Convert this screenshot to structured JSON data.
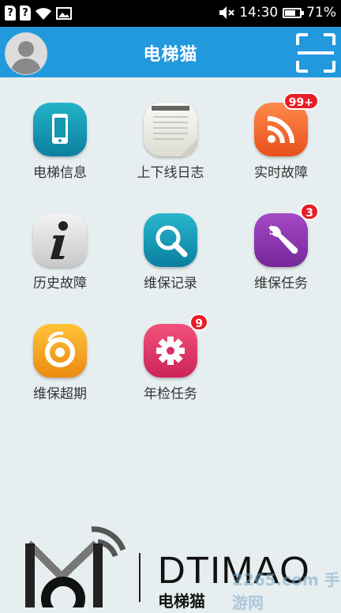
{
  "status_bar": {
    "sim1": "?",
    "sim2": "?",
    "time": "14:30",
    "battery": "71%",
    "battery_level": 0.71
  },
  "app_bar": {
    "title": "电梯猫"
  },
  "grid": {
    "items": [
      {
        "label": "电梯信息",
        "badge": ""
      },
      {
        "label": "上下线日志",
        "badge": ""
      },
      {
        "label": "实时故障",
        "badge": "99+"
      },
      {
        "label": "历史故障",
        "badge": ""
      },
      {
        "label": "维保记录",
        "badge": ""
      },
      {
        "label": "维保任务",
        "badge": "3"
      },
      {
        "label": "维保超期",
        "badge": ""
      },
      {
        "label": "年检任务",
        "badge": "9"
      }
    ]
  },
  "footer": {
    "brand": "DTIMAO",
    "brand_cn": "电梯猫"
  },
  "watermark": "2265.com 手游网"
}
